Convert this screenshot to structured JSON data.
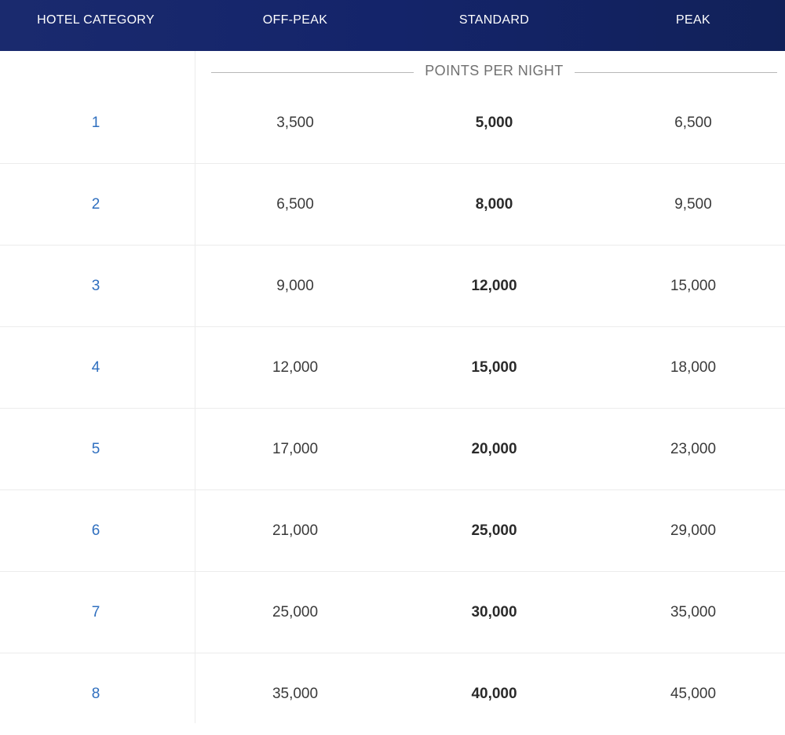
{
  "header": {
    "category": "HOTEL CATEGORY",
    "off_peak": "OFF-PEAK",
    "standard": "STANDARD",
    "peak": "PEAK"
  },
  "subheader": "POINTS PER NIGHT",
  "colors": {
    "header_bg": "#14246a",
    "category_link": "#2f6fbf"
  },
  "rows": [
    {
      "category": "1",
      "off_peak": "3,500",
      "standard": "5,000",
      "peak": "6,500"
    },
    {
      "category": "2",
      "off_peak": "6,500",
      "standard": "8,000",
      "peak": "9,500"
    },
    {
      "category": "3",
      "off_peak": "9,000",
      "standard": "12,000",
      "peak": "15,000"
    },
    {
      "category": "4",
      "off_peak": "12,000",
      "standard": "15,000",
      "peak": "18,000"
    },
    {
      "category": "5",
      "off_peak": "17,000",
      "standard": "20,000",
      "peak": "23,000"
    },
    {
      "category": "6",
      "off_peak": "21,000",
      "standard": "25,000",
      "peak": "29,000"
    },
    {
      "category": "7",
      "off_peak": "25,000",
      "standard": "30,000",
      "peak": "35,000"
    },
    {
      "category": "8",
      "off_peak": "35,000",
      "standard": "40,000",
      "peak": "45,000"
    }
  ]
}
